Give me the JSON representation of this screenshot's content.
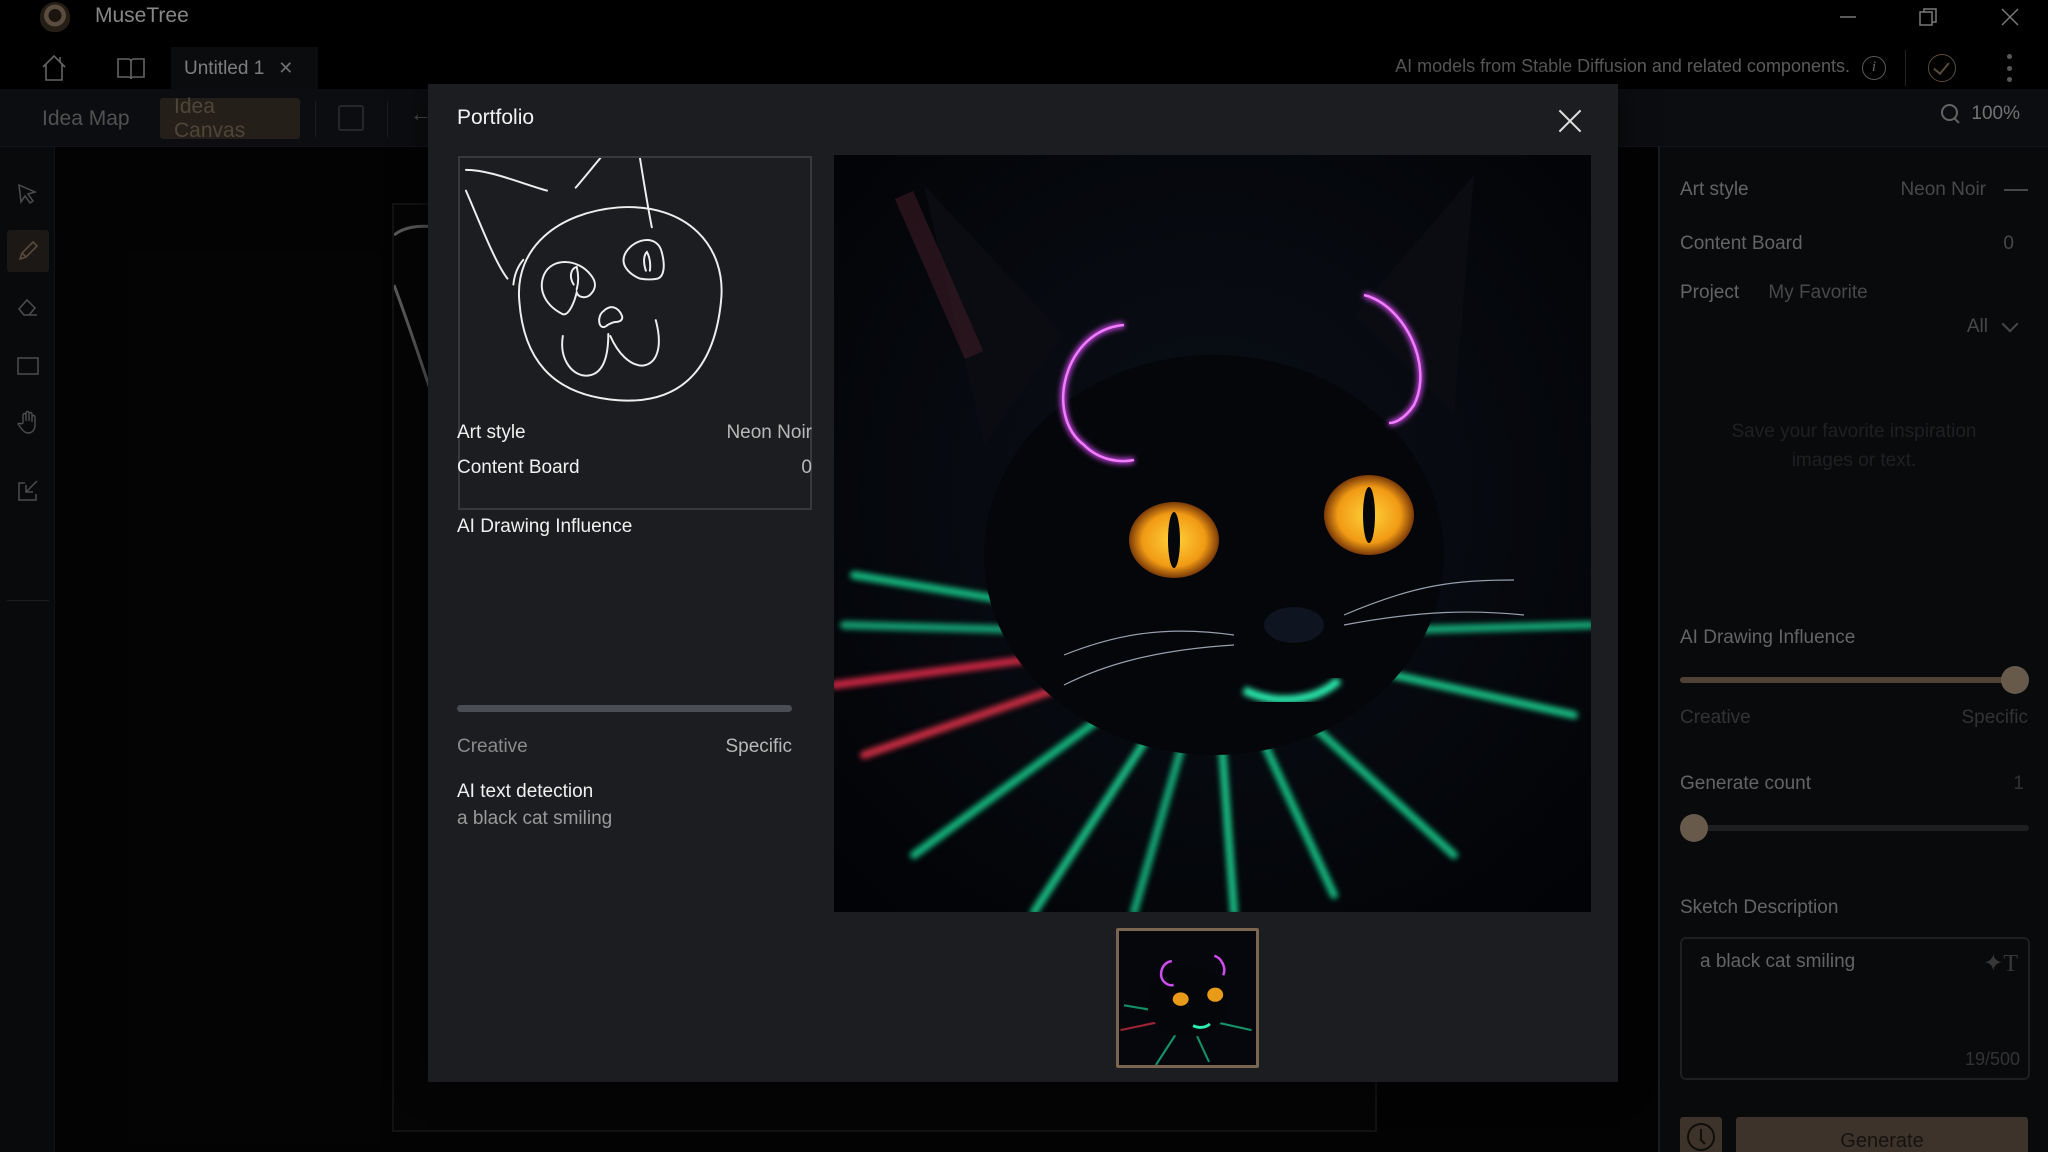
{
  "app": {
    "title": "MuseTree",
    "document_tab": "Untitled 1",
    "notice": "AI models from Stable Diffusion and related components.",
    "window_controls": [
      "minimize",
      "restore",
      "close"
    ]
  },
  "toolbar": {
    "modes": [
      {
        "label": "Idea Map",
        "active": false
      },
      {
        "label": "Idea Canvas",
        "active": true
      }
    ],
    "zoom_level": "100%"
  },
  "tools": [
    {
      "name": "select",
      "icon": "cursor-icon",
      "active": false
    },
    {
      "name": "pencil",
      "icon": "pencil-icon",
      "active": true
    },
    {
      "name": "eraser",
      "icon": "eraser-icon",
      "active": false
    },
    {
      "name": "rectangle",
      "icon": "rectangle-icon",
      "active": false
    },
    {
      "name": "pan",
      "icon": "hand-icon",
      "active": false
    },
    {
      "name": "import",
      "icon": "import-icon",
      "active": false
    }
  ],
  "right_panel": {
    "art_style_label": "Art style",
    "art_style_value": "Neon Noir",
    "content_board_label": "Content Board",
    "content_board_value": "0",
    "project_label": "Project",
    "project_value": "My Favorite",
    "filter_value": "All",
    "empty_hint": "Save your favorite inspiration images or text.",
    "influence_label": "AI Drawing Influence",
    "influence_value": 0.96,
    "influence_min_label": "Creative",
    "influence_max_label": "Specific",
    "count_label": "Generate count",
    "count_value": "1",
    "count_fraction": 0.0,
    "description_label": "Sketch Description",
    "description_value": "a black cat smiling",
    "char_count": "19/500",
    "generate_label": "Generate",
    "accent_color": "#a08a74"
  },
  "modal": {
    "title": "Portfolio",
    "art_style_label": "Art style",
    "art_style_value": "Neon Noir",
    "content_board_label": "Content Board",
    "content_board_value": "0",
    "influence_label": "AI Drawing Influence",
    "influence_min_label": "Creative",
    "influence_max_label": "Specific",
    "text_detection_label": "AI text detection",
    "text_detection_value": "a black cat smiling",
    "thumbnails": [
      {
        "selected": true,
        "alt": "Neon black cat"
      }
    ]
  }
}
